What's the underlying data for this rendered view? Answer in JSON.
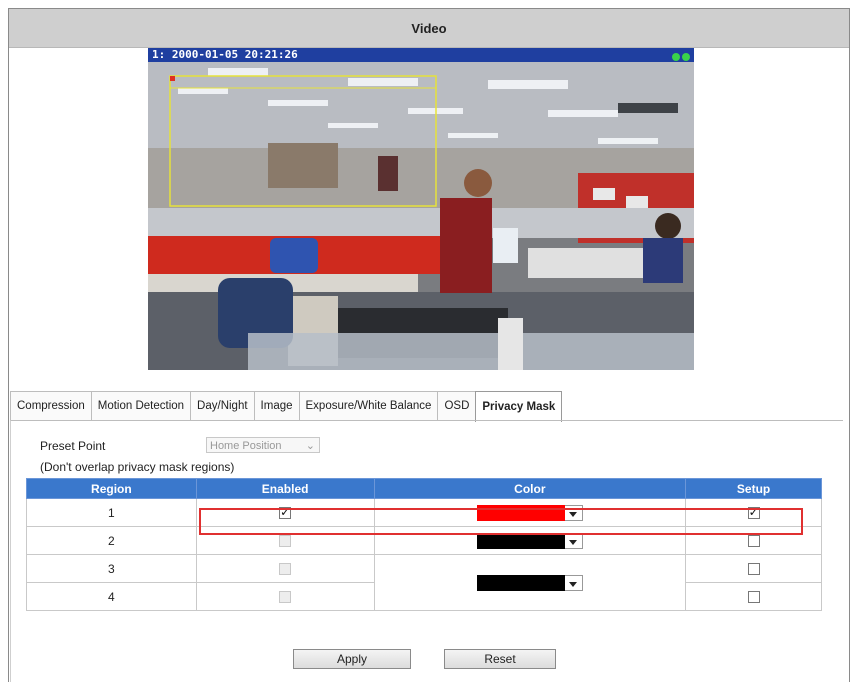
{
  "window": {
    "title": "Video"
  },
  "video": {
    "osd_text": "1:  2000-01-05 20:21:26"
  },
  "tabs": [
    {
      "label": "Compression"
    },
    {
      "label": "Motion Detection"
    },
    {
      "label": "Day/Night"
    },
    {
      "label": "Image"
    },
    {
      "label": "Exposure/White Balance"
    },
    {
      "label": "OSD"
    },
    {
      "label": "Privacy Mask",
      "active": true
    }
  ],
  "privacy": {
    "preset_label": "Preset Point",
    "preset_value": "Home Position",
    "note": "(Don't overlap privacy mask regions)",
    "columns": [
      "Region",
      "Enabled",
      "Color",
      "Setup"
    ],
    "rows": [
      {
        "region": "1",
        "enabled": true,
        "enabled_disabled": false,
        "color": "#ff0000",
        "setup": true
      },
      {
        "region": "2",
        "enabled": false,
        "enabled_disabled": true,
        "color": "#000000",
        "setup": false
      },
      {
        "region": "3",
        "enabled": false,
        "enabled_disabled": true,
        "color": "#000000",
        "setup": false
      },
      {
        "region": "4",
        "enabled": false,
        "enabled_disabled": true,
        "color": "#000000",
        "setup": false
      }
    ],
    "apply_label": "Apply",
    "reset_label": "Reset"
  },
  "colors": {
    "header_blue": "#3a78cc",
    "highlight": "#e03030",
    "osd_bar": "#1f3fa0"
  }
}
